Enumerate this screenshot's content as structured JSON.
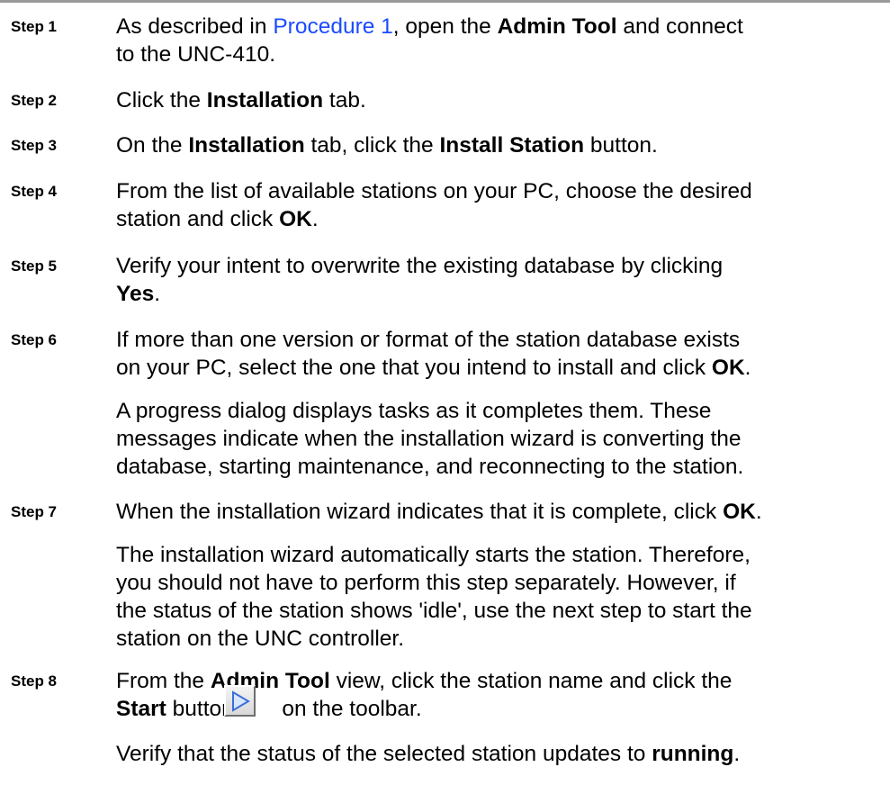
{
  "steps": [
    {
      "label": "Step 1",
      "parts": [
        "As described in ",
        "Procedure 1",
        ", open the ",
        "Admin Tool",
        " and connect",
        "to the UNC-410."
      ]
    },
    {
      "label": "Step 2",
      "parts": [
        "Click the ",
        "Installation",
        " tab."
      ]
    },
    {
      "label": "Step 3",
      "parts": [
        "On the ",
        "Installation",
        " tab, click the ",
        "Install Station",
        " button."
      ]
    },
    {
      "label": "Step 4",
      "parts": [
        "From the list of available stations on your PC, choose the desired",
        "station and click ",
        "OK",
        "."
      ]
    },
    {
      "label": "Step 5",
      "parts": [
        "Verify your intent to overwrite the existing database by clicking",
        "Yes",
        "."
      ]
    },
    {
      "label": "Step 6",
      "parts": [
        "If more than one version or format of the station database exists",
        "on your PC, select the one that you intend to install and click ",
        "OK",
        "."
      ],
      "note": [
        "A progress dialog displays tasks as it completes them. These",
        "messages indicate when the installation wizard is converting the",
        "database, starting maintenance, and reconnecting to the station."
      ]
    },
    {
      "label": "Step 7",
      "parts": [
        "When the installation wizard indicates that it is complete, click ",
        "OK",
        "."
      ],
      "note": [
        "The installation wizard automatically starts the station. Therefore,",
        "you should not have to perform this step separately. However, if",
        "the status of the station shows 'idle', use the next step to start the",
        "station on the UNC controller."
      ]
    },
    {
      "label": "Step 8",
      "parts": [
        "From the ",
        "Admin Tool",
        " view, click the station name and click the",
        "Start",
        " button ",
        " on the toolbar."
      ],
      "note": [
        "Verify that the status of the selected station updates to ",
        "running",
        "."
      ]
    }
  ],
  "colors": {
    "link": "#1a4bff",
    "rule": "#9a9a9a",
    "play_icon": "#3a6fd8"
  },
  "icons": {
    "toolbar_start": "play-icon"
  }
}
